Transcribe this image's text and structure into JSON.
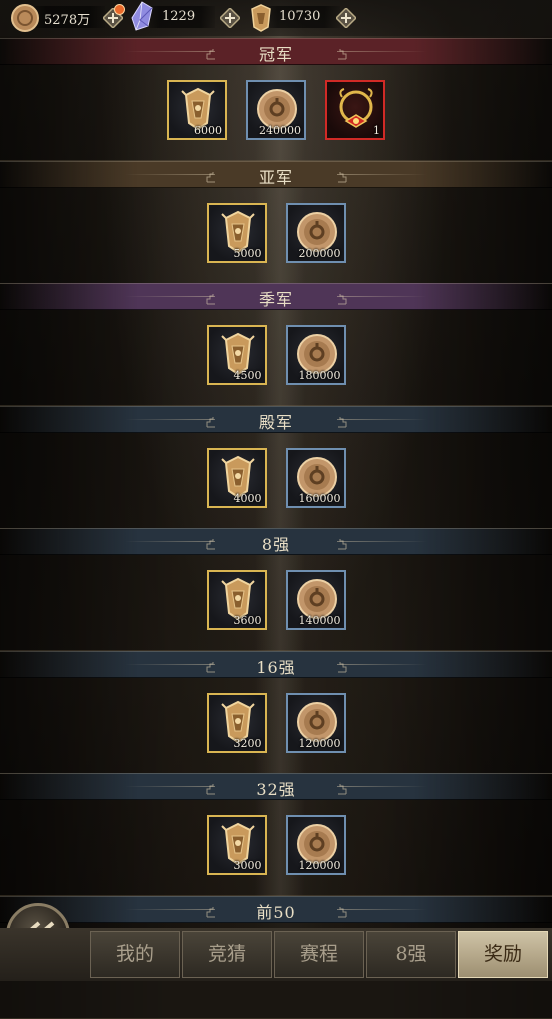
{
  "resources": [
    {
      "icon": "copper-coin-icon",
      "value": "5278万"
    },
    {
      "icon": "crystal-icon",
      "value": "1229"
    },
    {
      "icon": "honor-badge-icon",
      "value": "10730"
    }
  ],
  "tiers": [
    {
      "label": "冠军",
      "theme": "red",
      "rewards": [
        {
          "icon": "honor-badge-icon",
          "qty": "6000",
          "frame": "gold"
        },
        {
          "icon": "copper-coin-icon",
          "qty": "240000",
          "frame": "blue"
        },
        {
          "icon": "crown-frame-icon",
          "qty": "1",
          "frame": "red"
        }
      ]
    },
    {
      "label": "亚军",
      "theme": "gold",
      "rewards": [
        {
          "icon": "honor-badge-icon",
          "qty": "5000",
          "frame": "gold"
        },
        {
          "icon": "copper-coin-icon",
          "qty": "200000",
          "frame": "blue"
        }
      ]
    },
    {
      "label": "季军",
      "theme": "purple",
      "rewards": [
        {
          "icon": "honor-badge-icon",
          "qty": "4500",
          "frame": "gold"
        },
        {
          "icon": "copper-coin-icon",
          "qty": "180000",
          "frame": "blue"
        }
      ]
    },
    {
      "label": "殿军",
      "theme": "blue",
      "rewards": [
        {
          "icon": "honor-badge-icon",
          "qty": "4000",
          "frame": "gold"
        },
        {
          "icon": "copper-coin-icon",
          "qty": "160000",
          "frame": "blue"
        }
      ]
    },
    {
      "label": "8强",
      "theme": "blue",
      "rewards": [
        {
          "icon": "honor-badge-icon",
          "qty": "3600",
          "frame": "gold"
        },
        {
          "icon": "copper-coin-icon",
          "qty": "140000",
          "frame": "blue"
        }
      ]
    },
    {
      "label": "16强",
      "theme": "blue",
      "rewards": [
        {
          "icon": "honor-badge-icon",
          "qty": "3200",
          "frame": "gold"
        },
        {
          "icon": "copper-coin-icon",
          "qty": "120000",
          "frame": "blue"
        }
      ]
    },
    {
      "label": "32强",
      "theme": "blue",
      "rewards": [
        {
          "icon": "honor-badge-icon",
          "qty": "3000",
          "frame": "gold"
        },
        {
          "icon": "copper-coin-icon",
          "qty": "120000",
          "frame": "blue"
        }
      ]
    },
    {
      "label": "前50",
      "theme": "blue",
      "rewards": []
    }
  ],
  "tabs": [
    {
      "label": "我的",
      "active": false
    },
    {
      "label": "竞猜",
      "active": false
    },
    {
      "label": "赛程",
      "active": false
    },
    {
      "label": "8强",
      "active": false
    },
    {
      "label": "奖励",
      "active": true
    }
  ],
  "colors": {
    "red_header": "#5b2227",
    "gold_header": "#4a3a27",
    "purple_header": "#4f3557",
    "blue_header": "#27333f",
    "gold_frame": "#d9b552",
    "blue_frame": "#6f8fb0",
    "red_frame": "#d12a26"
  }
}
